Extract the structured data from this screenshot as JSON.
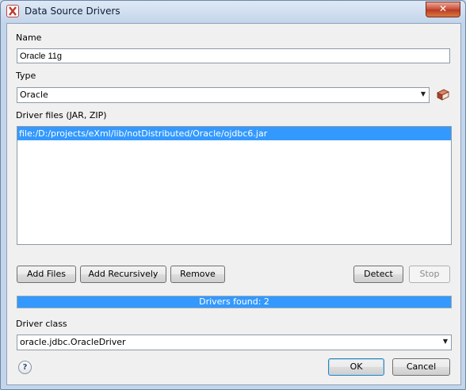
{
  "window": {
    "title": "Data Source Drivers",
    "close_label": "✕"
  },
  "name": {
    "label": "Name",
    "value": "Oracle 11g"
  },
  "type": {
    "label": "Type",
    "value": "Oracle"
  },
  "driver_files": {
    "label": "Driver files (JAR, ZIP)",
    "items": [
      "file:/D:/projects/eXml/lib/notDistributed/Oracle/ojdbc6.jar"
    ]
  },
  "buttons": {
    "add_files": "Add Files",
    "add_recursively": "Add Recursively",
    "remove": "Remove",
    "detect": "Detect",
    "stop": "Stop",
    "ok": "OK",
    "cancel": "Cancel"
  },
  "progress": {
    "text": "Drivers found: 2",
    "fraction": 1.0
  },
  "driver_class": {
    "label": "Driver class",
    "value": "oracle.jdbc.OracleDriver"
  },
  "icons": {
    "app": "xml-app-icon",
    "type_details": "book-icon",
    "help": "help-icon"
  },
  "colors": {
    "selection": "#3399ff",
    "window_frame": "#c3d5ea"
  }
}
